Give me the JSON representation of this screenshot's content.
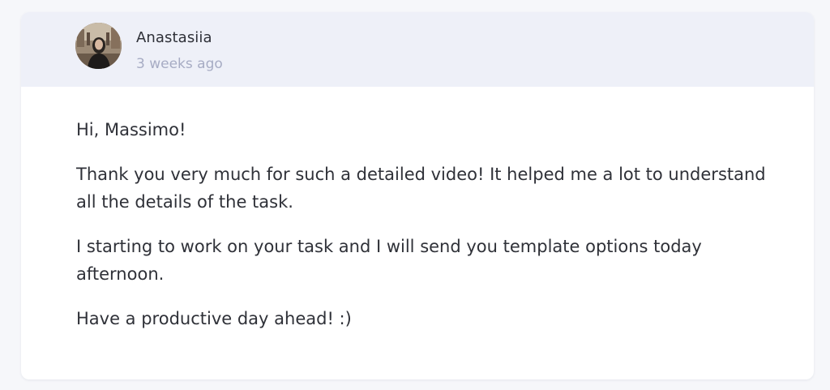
{
  "comment": {
    "author": {
      "name": "Anastasiia",
      "avatar_icon": "user-photo-avatar"
    },
    "timestamp": "3 weeks ago",
    "paragraphs": [
      "Hi, Massimo!",
      "Thank you very much for such a detailed video! It helped me a lot to understand all the details of the task.",
      "I starting to work on your task and I will send you template options today afternoon.",
      "Have a productive day ahead! :)"
    ]
  },
  "colors": {
    "page_background": "#f6f7fa",
    "card_background": "#ffffff",
    "header_background": "#eef0f8",
    "text_primary": "#2f3138",
    "text_muted": "#a7acc4"
  }
}
